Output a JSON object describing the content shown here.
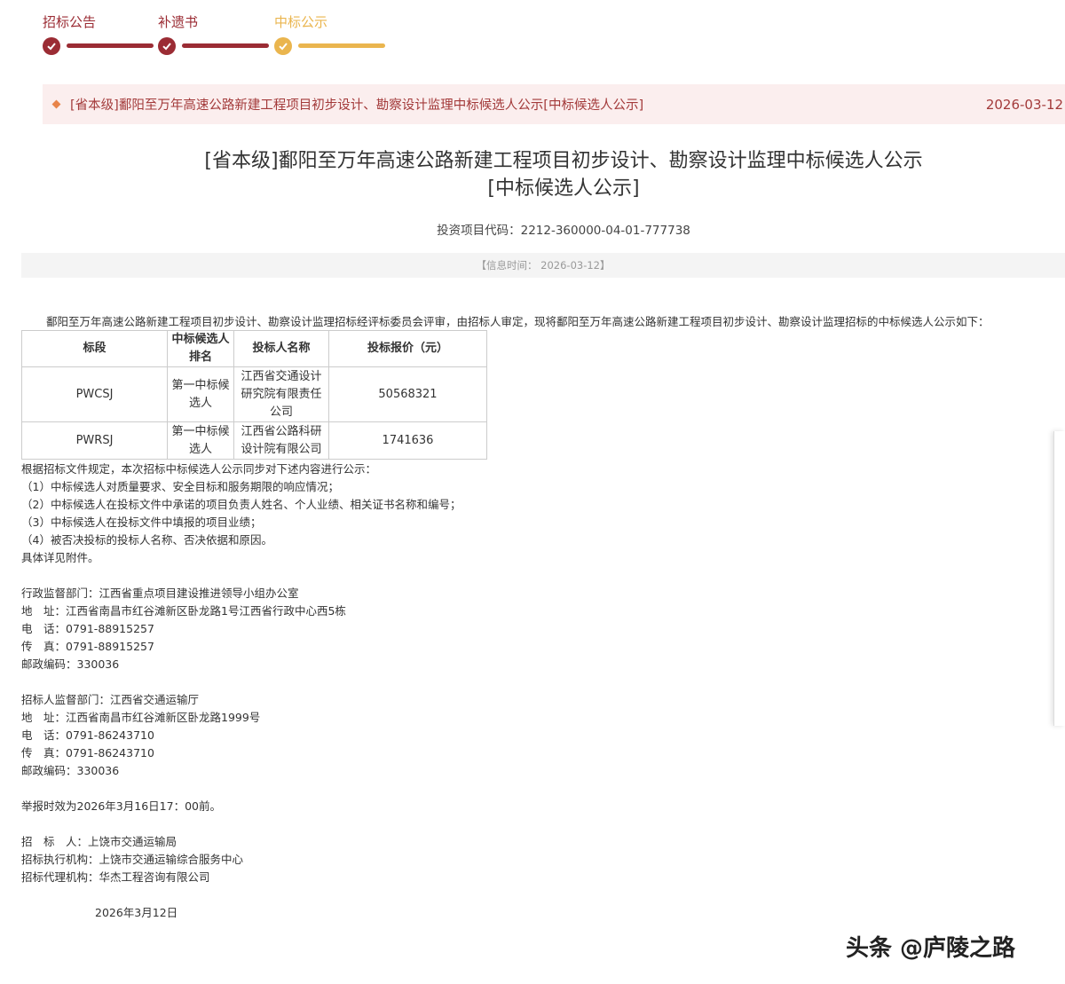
{
  "colors": {
    "done": "#9b2c34",
    "current": "#eab54e",
    "notice_text": "#a33a3a",
    "notice_bg": "#fbeeee"
  },
  "steps": [
    {
      "label": "招标公告",
      "state": "done",
      "icon": "check-icon"
    },
    {
      "label": "补遗书",
      "state": "done",
      "icon": "check-icon"
    },
    {
      "label": "中标公示",
      "state": "current",
      "icon": "check-icon"
    }
  ],
  "notice": {
    "title": "[省本级]鄱阳至万年高速公路新建工程项目初步设计、勘察设计监理中标候选人公示[中标候选人公示]",
    "date": "2026-03-12"
  },
  "article": {
    "title_line1": "[省本级]鄱阳至万年高速公路新建工程项目初步设计、勘察设计监理中标候选人公示",
    "title_line2": "[中标候选人公示]",
    "project_code": "投资项目代码：2212-360000-04-01-777738",
    "info_time": "【信息时间： 2026-03-12】",
    "intro": "鄱阳至万年高速公路新建工程项目初步设计、勘察设计监理招标经评标委员会评审，由招标人审定，现将鄱阳至万年高速公路新建工程项目初步设计、勘察设计监理招标的中标候选人公示如下："
  },
  "table": {
    "headers": [
      "标段",
      "中标候选人排名",
      "投标人名称",
      "投标报价（元）"
    ],
    "rows": [
      [
        "PWCSJ",
        "第一中标候选人",
        "江西省交通设计研究院有限责任公司",
        "50568321"
      ],
      [
        "PWRSJ",
        "第一中标候选人",
        "江西省公路科研设计院有限公司",
        "1741636"
      ]
    ]
  },
  "body": {
    "p1": "根据招标文件规定，本次招标中标候选人公示同步对下述内容进行公示：",
    "p2": "（1）中标候选人对质量要求、安全目标和服务期限的响应情况；",
    "p3": "（2）中标候选人在投标文件中承诺的项目负责人姓名、个人业绩、相关证书名称和编号；",
    "p4": "（3）中标候选人在投标文件中填报的项目业绩；",
    "p5": "（4）被否决投标的投标人名称、否决依据和原因。",
    "p6": "具体详见附件。",
    "admin_dept": "行政监督部门：江西省重点项目建设推进领导小组办公室",
    "admin_addr": "地　址：江西省南昌市红谷滩新区卧龙路1号江西省行政中心西5栋",
    "admin_tel": "电　话：0791-88915257",
    "admin_fax": "传　真：0791-88915257",
    "admin_zip": "邮政编码：330036",
    "owner_dept": "招标人监督部门：江西省交通运输厅",
    "owner_addr": "地　址：江西省南昌市红谷滩新区卧龙路1999号",
    "owner_tel": "电　话：0791-86243710",
    "owner_fax": "传　真：0791-86243710",
    "owner_zip": "邮政编码：330036",
    "report_deadline": "举报时效为2026年3月16日17：00前。",
    "tenderer": "招　标　人：上饶市交通运输局",
    "executor": "招标执行机构：上饶市交通运输综合服务中心",
    "agent": "招标代理机构：华杰工程咨询有限公司",
    "sign_date": "2026年3月12日"
  },
  "watermark": "头条 @庐陵之路"
}
